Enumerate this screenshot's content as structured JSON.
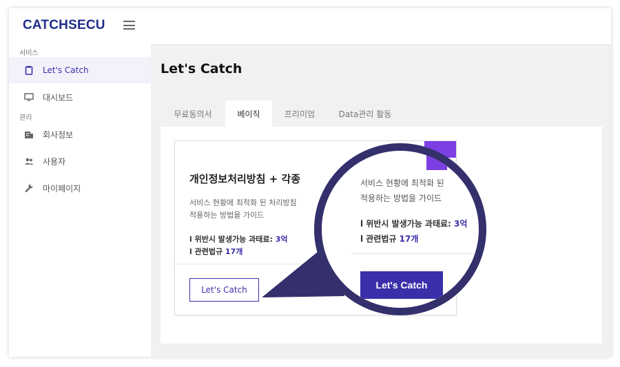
{
  "app": {
    "logo": "CATCHSECU"
  },
  "sidebar": {
    "sections": [
      {
        "label": "서비스"
      },
      {
        "label": "관리"
      }
    ],
    "items": [
      {
        "label": "Let's Catch",
        "icon": "clipboard-icon"
      },
      {
        "label": "대시보드",
        "icon": "monitor-icon"
      },
      {
        "label": "회사정보",
        "icon": "building-icon"
      },
      {
        "label": "사용자",
        "icon": "users-icon"
      },
      {
        "label": "마이페이지",
        "icon": "wrench-icon"
      }
    ]
  },
  "main": {
    "title": "Let's Catch",
    "tabs": [
      {
        "label": "무료동의서"
      },
      {
        "label": "베이직"
      },
      {
        "label": "프리미엄"
      },
      {
        "label": "Data관리 활동"
      }
    ]
  },
  "card": {
    "title": "개인정보처리방침 + 각종",
    "desc_line1": "서비스 현황에 최적화 된 처리방침",
    "desc_line2": "적용하는 방법을 가이드",
    "fine_label": "l 위반시 발생가능 과태료: ",
    "fine_value": "3억",
    "laws_label": "l 관련법규 ",
    "laws_value": "17개",
    "button": "Let's Catch"
  },
  "magnifier": {
    "desc_line1": "서비스 현황에 최적화 된",
    "desc_line2": "적용하는 방법을 가이드",
    "fine_label": "l 위반시 발생가능 과태료: ",
    "fine_value": "3억",
    "laws_label": "l 관련법규 ",
    "laws_value": "17개",
    "button": "Let's Catch"
  },
  "colors": {
    "accent": "#3a2fa8",
    "logo": "#1f2c8a",
    "flag": "#7b3fe4",
    "magnifier_ring": "#34306c"
  }
}
